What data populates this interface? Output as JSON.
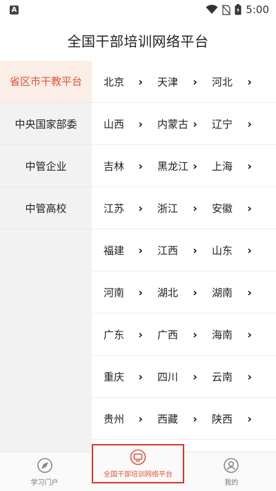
{
  "status_bar": {
    "app_badge": "A",
    "time": "5:00"
  },
  "header": {
    "title": "全国干部培训网络平台"
  },
  "sidebar": {
    "items": [
      {
        "label": "省区市干教平台",
        "active": true
      },
      {
        "label": "中央国家部委",
        "active": false
      },
      {
        "label": "中管企业",
        "active": false
      },
      {
        "label": "中管高校",
        "active": false
      }
    ]
  },
  "regions": [
    [
      "北京",
      "天津",
      "河北"
    ],
    [
      "山西",
      "内蒙古",
      "辽宁"
    ],
    [
      "吉林",
      "黑龙江",
      "上海"
    ],
    [
      "江苏",
      "浙江",
      "安徽"
    ],
    [
      "福建",
      "江西",
      "山东"
    ],
    [
      "河南",
      "湖北",
      "湖南"
    ],
    [
      "广东",
      "广西",
      "海南"
    ],
    [
      "重庆",
      "四川",
      "云南"
    ],
    [
      "贵州",
      "西藏",
      "陕西"
    ]
  ],
  "tab_bar": {
    "tabs": [
      {
        "label": "学习门户",
        "icon": "compass-icon",
        "active": false
      },
      {
        "label": "全国干部培训网络平台",
        "icon": "monitor-icon",
        "active": true
      },
      {
        "label": "我的",
        "icon": "user-icon",
        "active": false
      }
    ]
  },
  "colors": {
    "accent": "#e2533e",
    "sidebar_bg": "#f2f2f2",
    "active_bg": "#fbeee6"
  }
}
